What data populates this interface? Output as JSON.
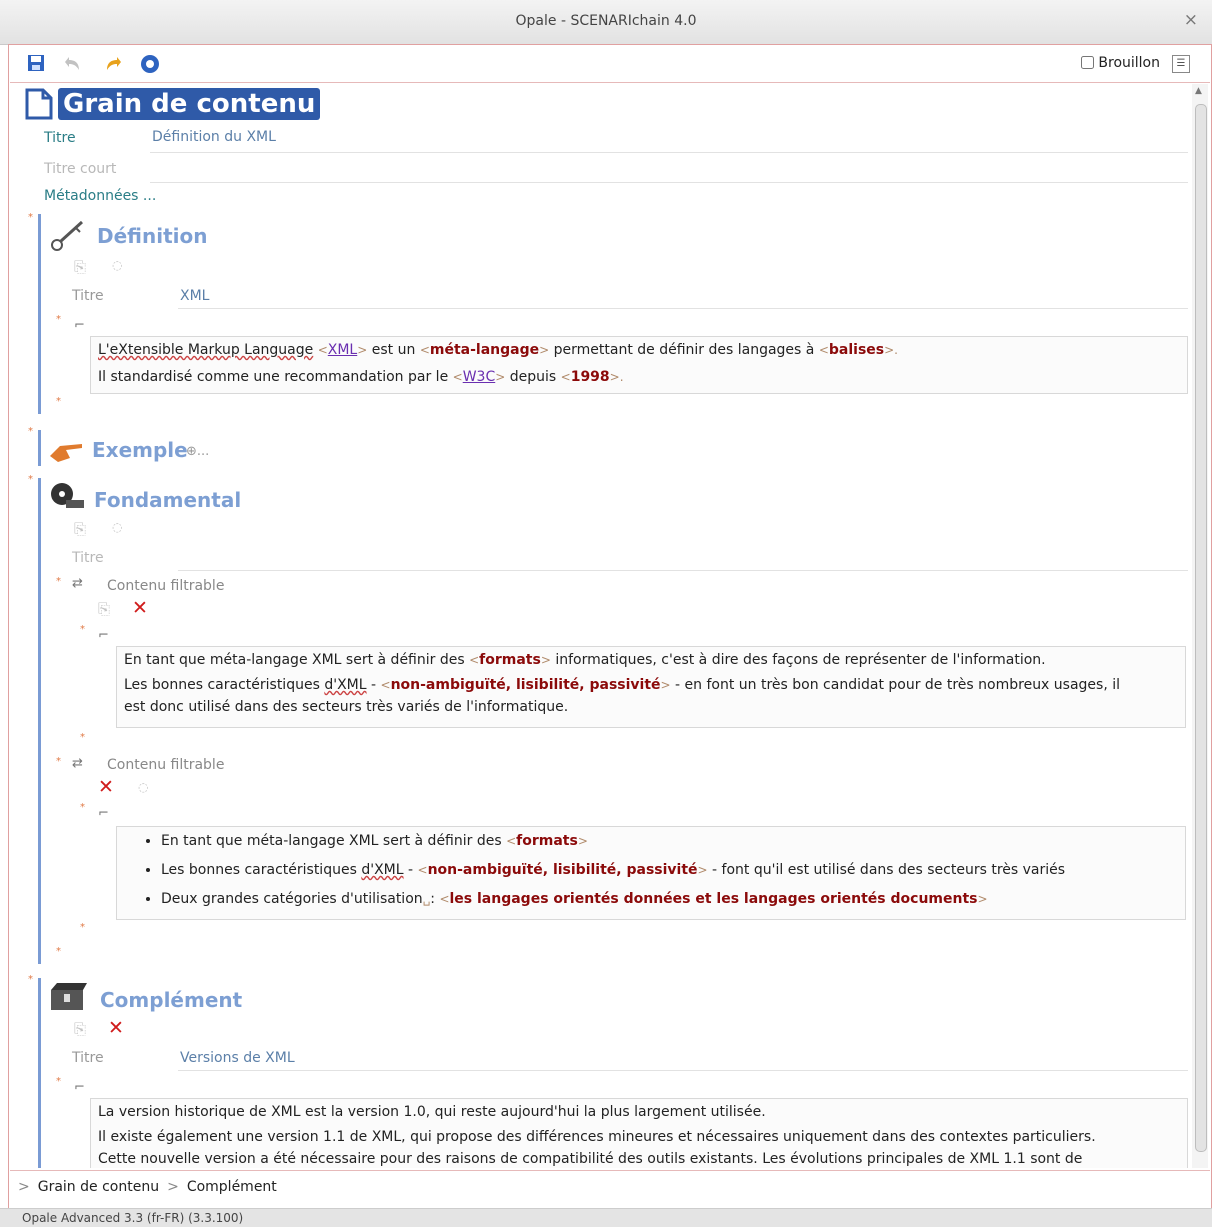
{
  "window": {
    "title": "Opale - SCENARIchain 4.0",
    "close_glyph": "×"
  },
  "toolbar": {
    "save_icon": "save-icon",
    "undo_icon": "undo-icon",
    "redo_icon": "redo-icon",
    "help_icon": "help-icon",
    "draft_label": "Brouillon"
  },
  "grain": {
    "title": "Grain de contenu",
    "titre_label": "Titre",
    "titre_value": "Définition du XML",
    "titre_court_label": "Titre court",
    "metadonnees_label": "Métadonnées ..."
  },
  "definition": {
    "title": "Définition",
    "titre_label": "Titre",
    "titre_value": "XML",
    "p1": {
      "a": "L'eXtensible Markup Language",
      "b": "<",
      "c": "XML",
      "d": ">",
      "e": " est un ",
      "f": "<",
      "g": "méta-langage",
      "h": ">",
      "i": " permettant de définir des langages à ",
      "j": "<",
      "k": "balises",
      "l": ">."
    },
    "p2": {
      "a": "Il standardisé comme une recommandation par le ",
      "b": "<",
      "c": "W3C",
      "d": ">",
      "e": " depuis ",
      "f": "<",
      "g": "1998",
      "h": ">."
    }
  },
  "exemple": {
    "title": "Exemple",
    "more": "⊕..."
  },
  "fondamental": {
    "title": "Fondamental",
    "titre_label": "Titre",
    "cf1_label": "Contenu filtrable",
    "cf1_p1": {
      "a": "En tant que méta-langage XML sert à définir des ",
      "b": "<",
      "c": "formats",
      "d": ">",
      "e": " informatiques, c'est à dire des façons de représenter de l'information."
    },
    "cf1_p2": {
      "a": "Les bonnes caractéristiques ",
      "b": "d'XML",
      "c": " - ",
      "d": "<",
      "e": "non-ambiguïté, lisibilité, passivité",
      "f": ">",
      "g": " - en font un très bon candidat pour de très nombreux usages, il"
    },
    "cf1_p3": "est donc utilisé dans des secteurs très variés de l'informatique.",
    "cf2_label": "Contenu filtrable",
    "li1": {
      "a": "En tant que méta-langage XML sert à définir des ",
      "b": "<",
      "c": "formats",
      "d": ">"
    },
    "li2": {
      "a": "Les bonnes caractéristiques ",
      "b": "d'XML",
      "c": " - ",
      "d": "<",
      "e": "non-ambiguïté, lisibilité, passivité",
      "f": ">",
      "g": " - font qu'il est utilisé dans des secteurs très variés"
    },
    "li3": {
      "a": "Deux grandes catégories d'utilisation",
      "b": "␣",
      "c": ": ",
      "d": "<",
      "e": "les langages orientés données et les langages orientés documents",
      "f": ">"
    }
  },
  "complement": {
    "title": "Complément",
    "titre_label": "Titre",
    "titre_value": "Versions de XML",
    "p1": "La version historique de XML est la version 1.0, qui reste aujourd'hui la plus largement utilisée.",
    "p2": "Il existe également une version 1.1 de XML, qui propose des différences mineures et nécessaires uniquement dans des contextes particuliers.",
    "p3": "Cette nouvelle version a été nécessaire pour des raisons de compatibilité des outils existants. Les évolutions principales de XML 1.1 sont de"
  },
  "breadcrumb": {
    "sep": ">",
    "item1": "Grain de contenu",
    "item2": "Complément"
  },
  "status": {
    "text": "Opale Advanced 3.3 (fr-FR) (3.3.100)"
  }
}
